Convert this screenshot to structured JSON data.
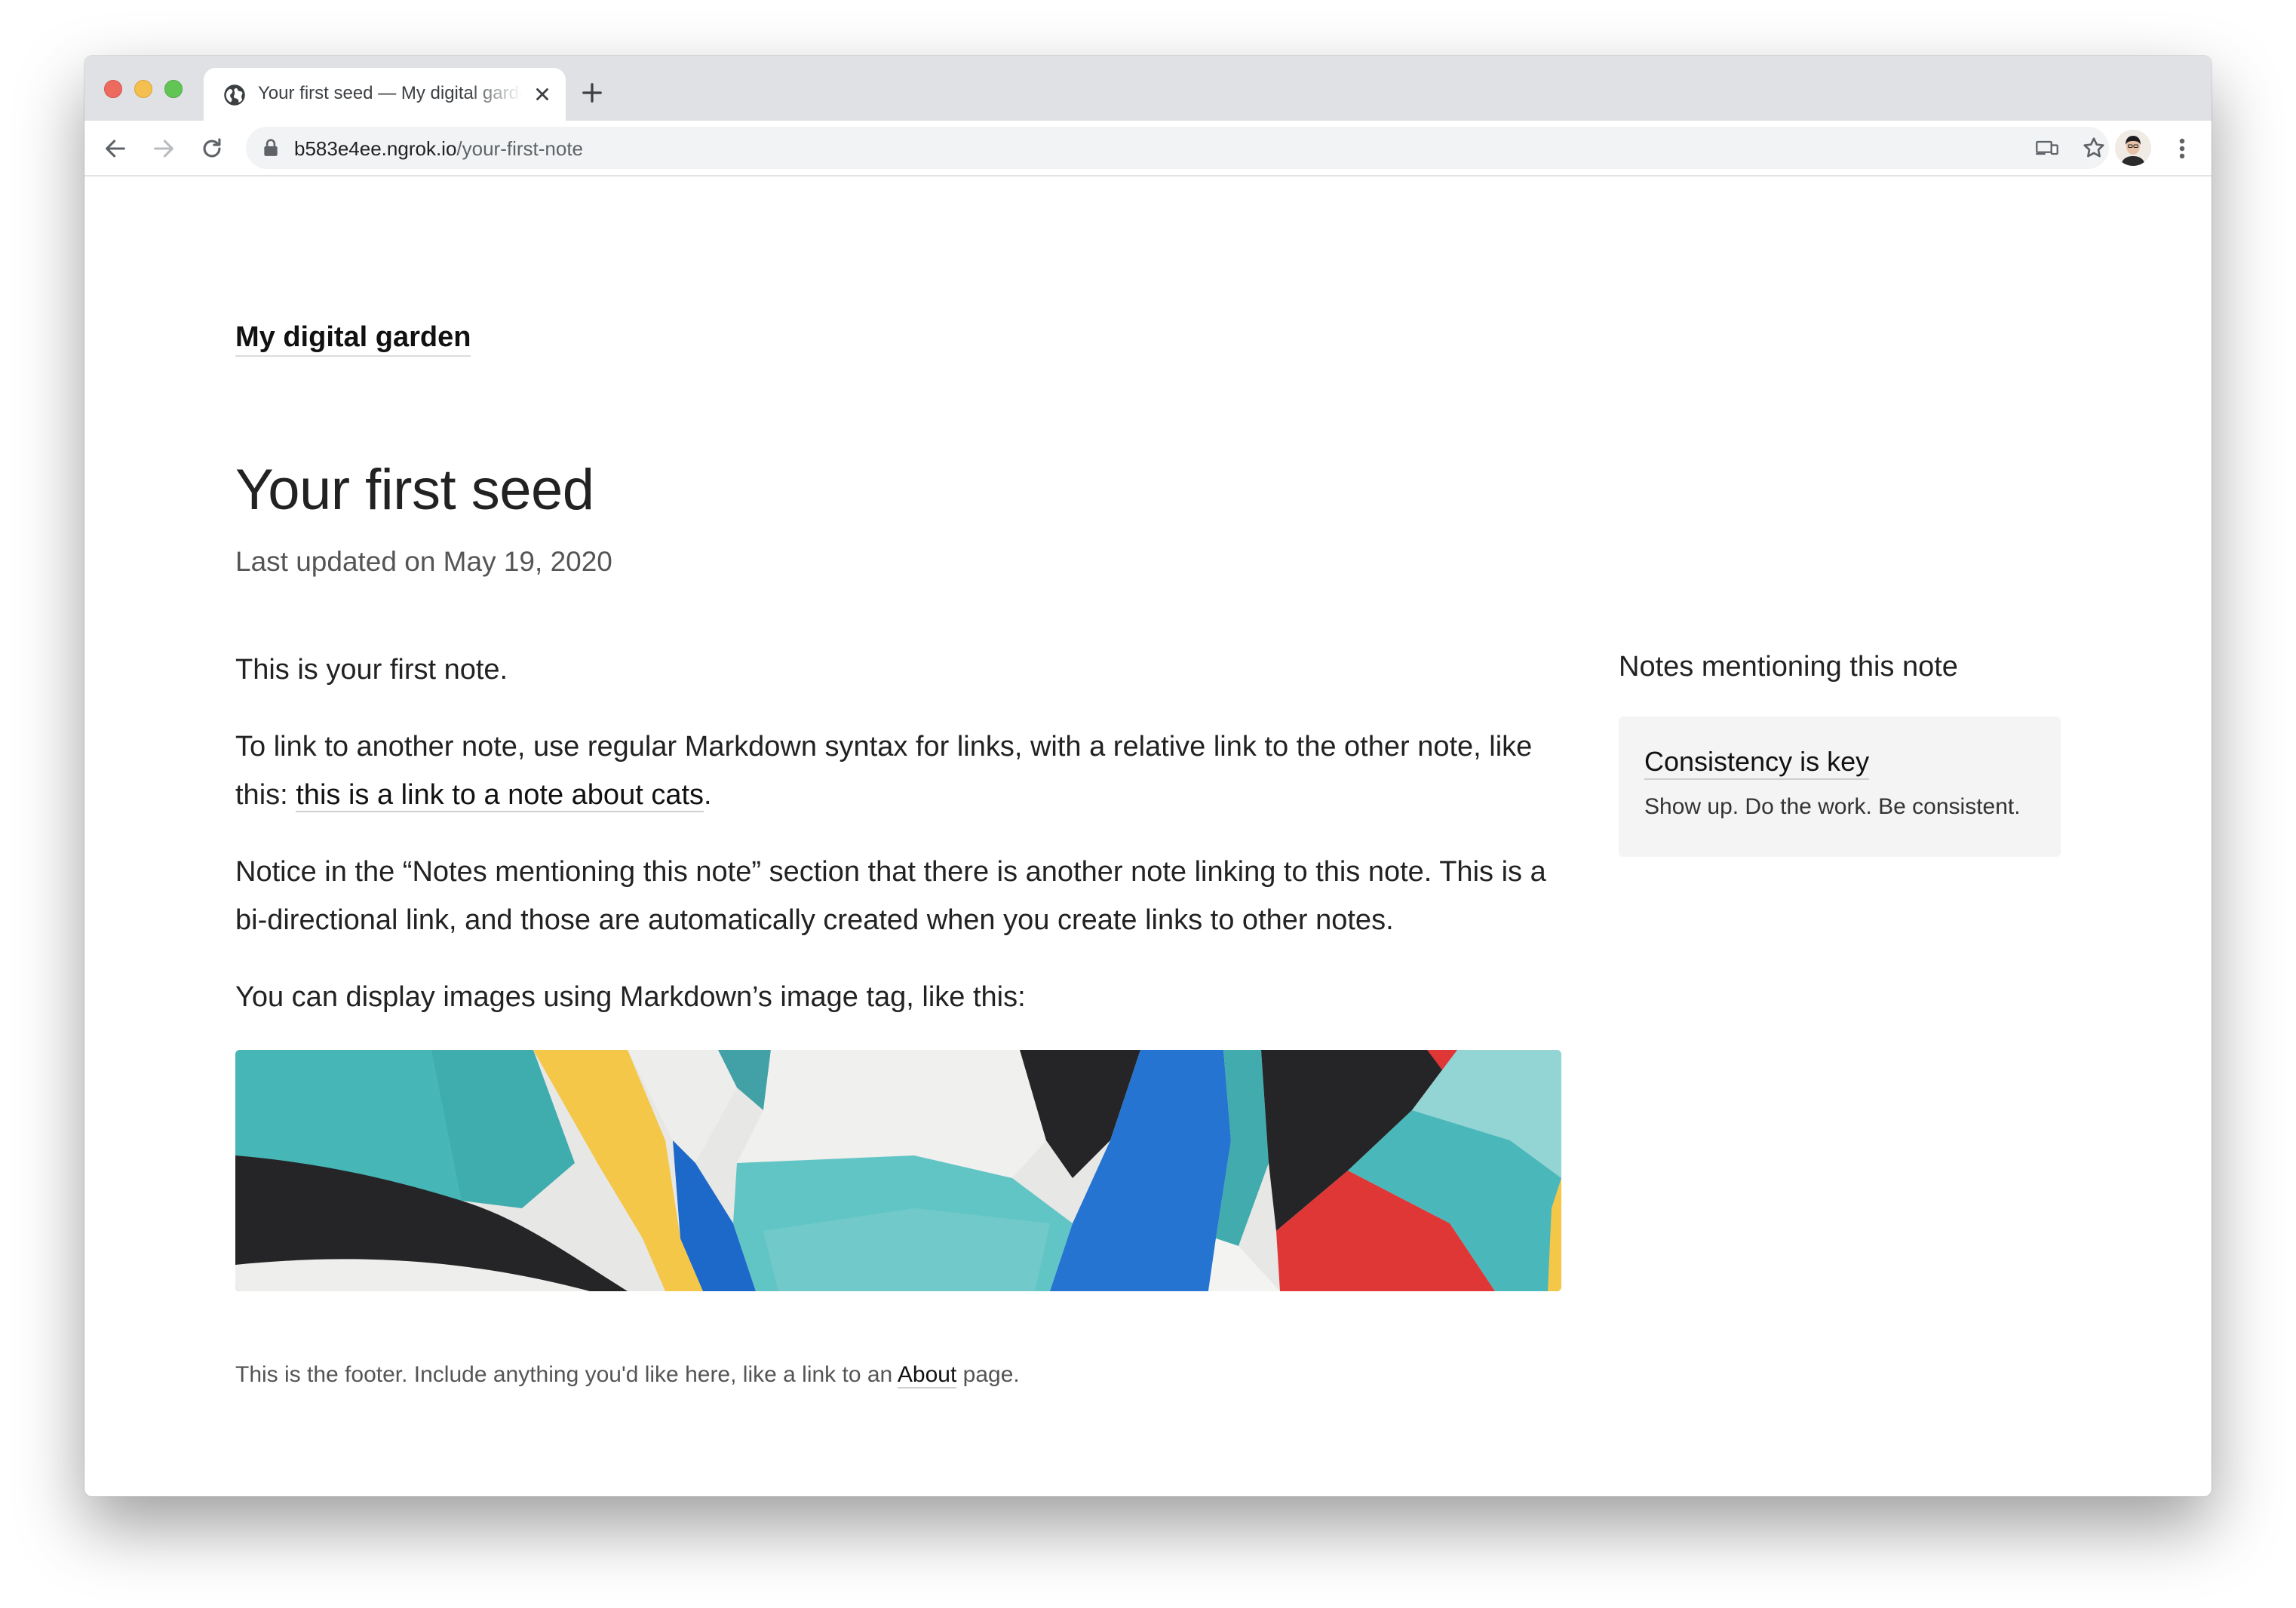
{
  "browser": {
    "tab": {
      "title": "Your first seed — My digital garden"
    },
    "address_bar": {
      "host": "b583e4ee.ngrok.io",
      "path": "/your-first-note"
    }
  },
  "site": {
    "title": "My digital garden"
  },
  "note": {
    "title": "Your first seed",
    "last_updated": "Last updated on May 19, 2020",
    "paragraphs": {
      "p1": "This is your first note.",
      "p2_before": "To link to another note, use regular Markdown syntax for links, with a relative link to the other note, like this: ",
      "p2_link": "this is a link to a note about cats",
      "p2_after": ".",
      "p3": "Notice in the “Notes mentioning this note” section that there is another note linking to this note. This is a bi-directional link, and those are automatically created when you create links to other notes.",
      "p4": "You can display images using Markdown’s image tag, like this:"
    },
    "image": {
      "description": "abstract colorful geometric mural"
    }
  },
  "backlinks": {
    "heading": "Notes mentioning this note",
    "items": [
      {
        "title": "Consistency is key",
        "excerpt": "Show up. Do the work. Be consistent."
      }
    ]
  },
  "footer": {
    "text_before": "This is the footer. Include anything you'd like here, like a link to an ",
    "link": "About",
    "text_after": " page."
  },
  "colors": {
    "mural_teal": "#3fb3b5",
    "mural_yellow": "#f4c542",
    "mural_blue": "#1463c8",
    "mural_red": "#de2e2e",
    "mural_black": "#1d1d1f"
  }
}
